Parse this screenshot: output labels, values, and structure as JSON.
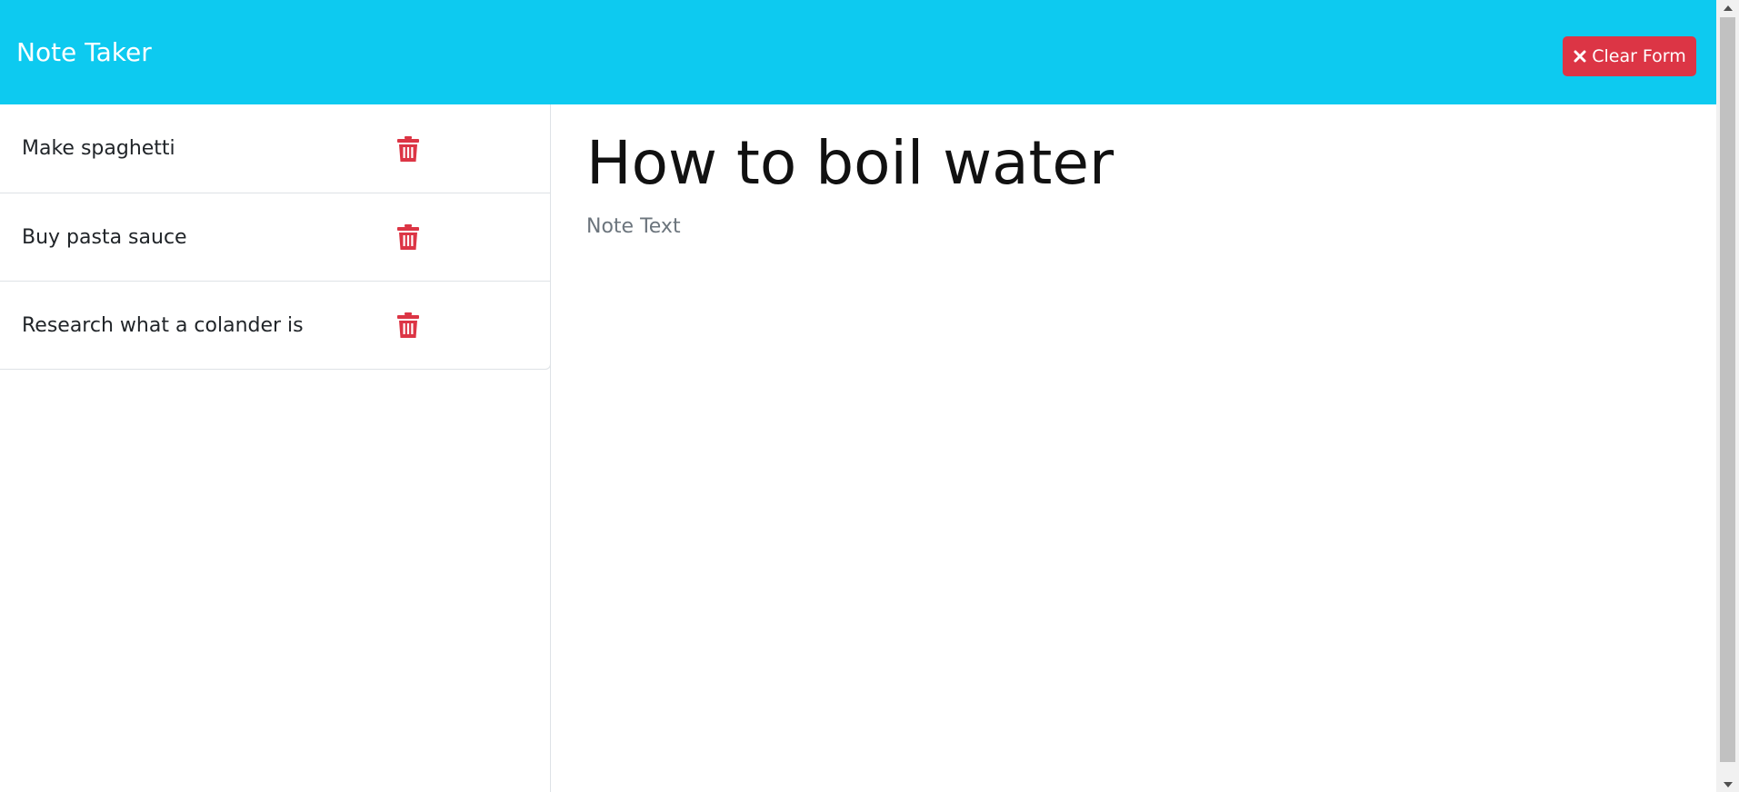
{
  "header": {
    "title": "Note Taker",
    "clear_label": "Clear Form",
    "clear_icon": "x-icon",
    "bg_color": "#0dcaf0",
    "button_color": "#dc3545"
  },
  "notes": [
    {
      "title": "Make spaghetti",
      "delete_icon": "trash-icon"
    },
    {
      "title": "Buy pasta sauce",
      "delete_icon": "trash-icon"
    },
    {
      "title": "Research what a colander is",
      "delete_icon": "trash-icon"
    }
  ],
  "editor": {
    "title_value": "How to boil water",
    "text_placeholder": "Note Text",
    "text_value": ""
  }
}
